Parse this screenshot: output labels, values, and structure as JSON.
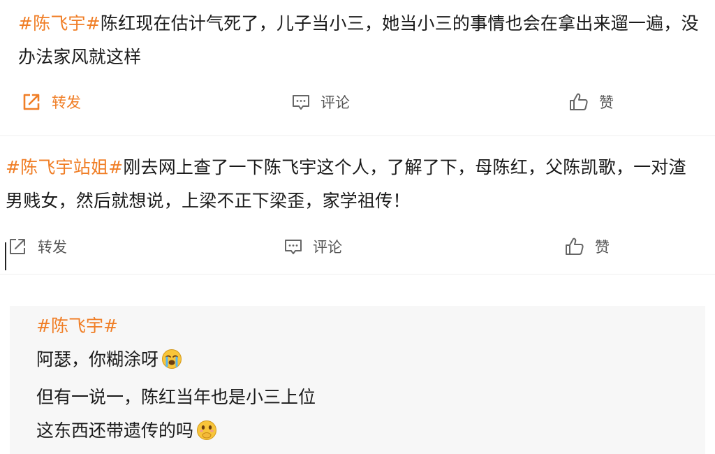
{
  "posts": [
    {
      "hashtag": "#陈飞宇#",
      "line1": "陈红现在估计气死了，儿子当小三，她当小三的事情也会在拿出来遛一遍，没",
      "line2": "办法家风就这样",
      "actions": {
        "forward": "转发",
        "comment": "评论",
        "like": "赞"
      }
    },
    {
      "hashtag": "#陈飞宇站姐#",
      "line1": "刚去网上查了一下陈飞宇这个人，了解了下，母陈红，父陈凯歌，一对渣",
      "line2": "男贱女，然后就想说，上梁不正下梁歪，家学祖传！",
      "actions": {
        "forward": "转发",
        "comment": "评论",
        "like": "赞"
      }
    }
  ],
  "quote": {
    "hashtag": "#陈飞宇#",
    "line1": "阿瑟，你糊涂呀",
    "line1_emoji": "crying-face-emoji",
    "line2": "但有一说一，陈红当年也是小三上位",
    "line3": "这东西还带遗传的吗",
    "line3_emoji": "hand-over-mouth-emoji"
  },
  "colors": {
    "hashtag": "#f07e26",
    "text": "#1a1a1a",
    "action": "#555555",
    "quote_bg": "#f7f7f7"
  }
}
